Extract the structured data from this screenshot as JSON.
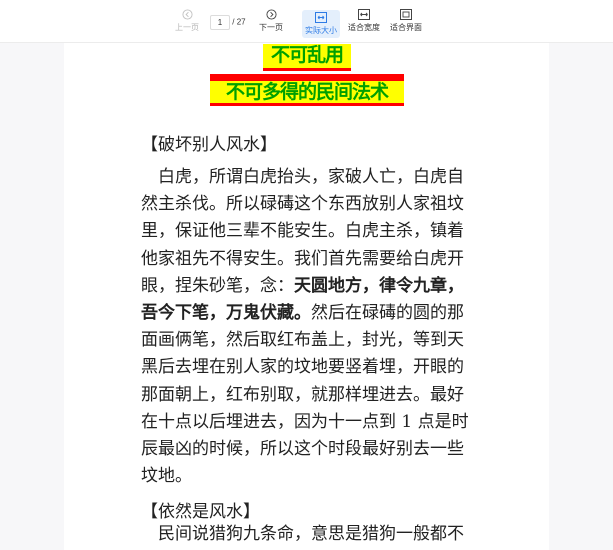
{
  "toolbar": {
    "prev_label": "上一页",
    "next_label": "下一页",
    "current_page": "1",
    "separator": "/",
    "total_pages": "27",
    "actual_size_label": "实际大小",
    "fit_width_label": "适合宽度",
    "fit_page_label": "适合界面"
  },
  "doc": {
    "banner1": "不可乱用",
    "banner2": "不可多得的民间法术",
    "section1_title": "【破坏别人风水】",
    "section1_lines": [
      "白虎，所谓白虎抬头，家破人亡，白虎自",
      "然主杀伐。所以碌碡这个东西放别人家祖坟",
      "里，保证他三辈不能安生。白虎主杀，镇着",
      "他家祖先不得安生。我们首先需要给白虎开"
    ],
    "line5_before": "眼，捏朱砂笔，念：",
    "incantation_a": "天圆地方，律令九章，",
    "incantation_b": "吾今下笔，万鬼伏藏。",
    "line6_after": "然后在碌碡的圆的那",
    "section1_lines_rest": [
      "面画俩笔，然后取红布盖上，封光，等到天",
      "黑后去埋在别人家的坟地要竖着埋，开眼的",
      "那面朝上，红布别取，就那样埋进去。最好",
      "在十点以后埋进去，因为十一点到 1 点是时",
      "辰最凶的时候，所以这个时段最好别去一些",
      "坟地。"
    ],
    "section2_title": "【依然是风水】",
    "section2_first_line": "民间说猎狗九条命，意思是猎狗一般都不"
  }
}
